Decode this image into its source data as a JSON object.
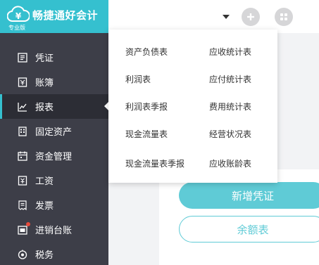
{
  "brand": {
    "name": "畅捷通好会计",
    "edition": "专业版"
  },
  "sidebar": {
    "items": [
      {
        "label": "凭证",
        "icon": "voucher-icon"
      },
      {
        "label": "账簿",
        "icon": "ledger-icon"
      },
      {
        "label": "报表",
        "icon": "chart-icon",
        "active": true
      },
      {
        "label": "固定资产",
        "icon": "building-icon"
      },
      {
        "label": "资金管理",
        "icon": "calendar-icon"
      },
      {
        "label": "工资",
        "icon": "salary-icon"
      },
      {
        "label": "发票",
        "icon": "invoice-icon"
      },
      {
        "label": "进销台账",
        "icon": "inventory-icon",
        "badge": true
      },
      {
        "label": "税务",
        "icon": "tax-icon"
      }
    ]
  },
  "topbar": {
    "add_icon": "plus-icon",
    "apps_icon": "grid-icon"
  },
  "report_menu": {
    "left": [
      "资产负债表",
      "利润表",
      "利润表季报",
      "现金流量表",
      "现金流量表季报"
    ],
    "right": [
      "应收统计表",
      "应付统计表",
      "费用统计表",
      "经营状况表",
      "应收账龄表"
    ]
  },
  "actions": {
    "new_voucher": "新增凭证",
    "balance_sheet": "余额表"
  },
  "colors": {
    "accent": "#35c0cf",
    "sidebar_bg": "#3d3e48",
    "sidebar_active_bg": "#2c2d35"
  }
}
